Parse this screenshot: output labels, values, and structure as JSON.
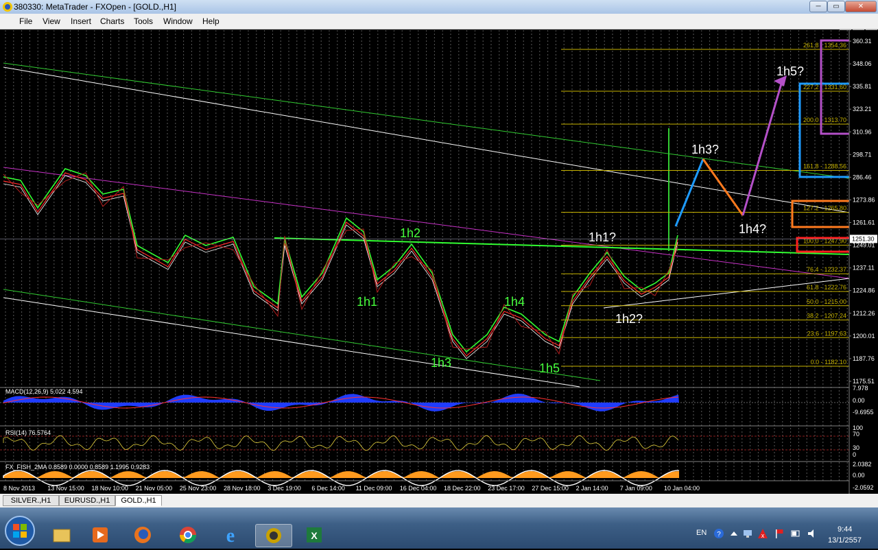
{
  "window": {
    "title": "380330: MetaTrader - FXOpen - [GOLD.,H1]"
  },
  "menu": [
    "File",
    "View",
    "Insert",
    "Charts",
    "Tools",
    "Window",
    "Help"
  ],
  "chart_data": {
    "type": "line",
    "symbol": "GOLD.,H1",
    "y_axis_ticks": [
      "360.31",
      "348.06",
      "335.81",
      "323.21",
      "310.96",
      "298.71",
      "286.46",
      "1273.86",
      "1261.61",
      "1249.01",
      "1237.11",
      "1224.86",
      "1212.26",
      "1200.01",
      "1187.76",
      "1175.51"
    ],
    "current_price": "1251.30",
    "x_axis_ticks": [
      "8 Nov 2013",
      "13 Nov 15:00",
      "18 Nov 10:00",
      "21 Nov 05:00",
      "25 Nov 23:00",
      "28 Nov 18:00",
      "3 Dec 19:00",
      "6 Dec 14:00",
      "11 Dec 09:00",
      "16 Dec 04:00",
      "18 Dec 22:00",
      "23 Dec 17:00",
      "27 Dec 15:00",
      "2 Jan 14:00",
      "7 Jan 09:00",
      "10 Jan 04:00"
    ],
    "fibonacci_levels": [
      {
        "label": "261.8 - 1354.36",
        "value": 1354.36
      },
      {
        "label": "227.2 - 1331.60",
        "value": 1331.6
      },
      {
        "label": "200.0 - 1313.70",
        "value": 1313.7
      },
      {
        "label": "161.8 - 1288.56",
        "value": 1288.56
      },
      {
        "label": "127.2 - 1265.80",
        "value": 1265.8
      },
      {
        "label": "100.0 - 1247.90",
        "value": 1247.9
      },
      {
        "label": "76.4 - 1232.37",
        "value": 1232.37
      },
      {
        "label": "61.8 - 1222.76",
        "value": 1222.76
      },
      {
        "label": "50.0 - 1215.00",
        "value": 1215.0
      },
      {
        "label": "38.2 - 1207.24",
        "value": 1207.24
      },
      {
        "label": "23.6 - 1197.63",
        "value": 1197.63
      },
      {
        "label": "0.0 - 1182.10",
        "value": 1182.1
      }
    ],
    "wave_labels": [
      "1h1",
      "1h2",
      "1h3",
      "1h4",
      "1h5",
      "1h1?",
      "1h2?",
      "1h3?",
      "1h4?",
      "1h5?"
    ],
    "macd": {
      "label": "MACD(12,26,9) 5.022 4.594",
      "ticks": [
        "7.978",
        "0.00",
        "-9.6955"
      ]
    },
    "rsi": {
      "label": "RSI(14) 76.5764",
      "ticks": [
        "100",
        "70",
        "30",
        "0"
      ]
    },
    "fisher": {
      "label": "FX_FISH_2MA 0.8589 0.0000 0.8589 1.1995 0.9283",
      "ticks": [
        "2.0382",
        "0.00",
        "-2.0592"
      ]
    }
  },
  "tabs": [
    "SILVER.,H1",
    "EURUSD.,H1",
    "GOLD.,H1"
  ],
  "taskbar": {
    "language": "EN",
    "time": "9:44",
    "date": "13/1/2557"
  },
  "colors": {
    "fib": "#c8b400",
    "box_red": "#ff1e1e",
    "box_orange": "#ff7a1e",
    "box_blue": "#1e9bff",
    "box_purple": "#b450c8",
    "trend_green": "#32cd32",
    "trend_magenta": "#c832c8",
    "wave_label": "#46ff3c"
  }
}
